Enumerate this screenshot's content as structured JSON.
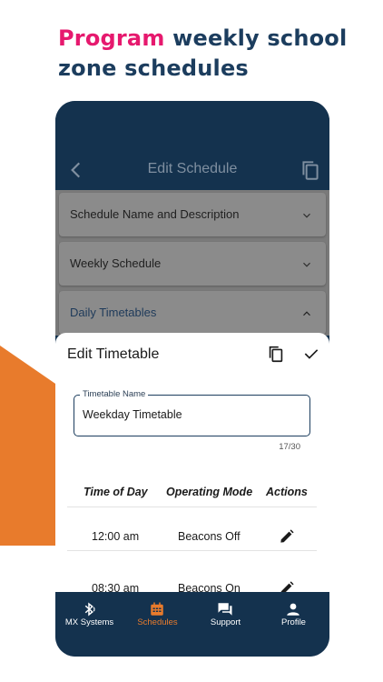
{
  "headline": {
    "accent": "Program",
    "rest": " weekly school zone schedules"
  },
  "colors": {
    "accent_pink": "#e6196e",
    "navy": "#14324e",
    "orange": "#e87b2c"
  },
  "appbar": {
    "title": "Edit Schedule",
    "back_icon": "chevron-left-icon",
    "copy_icon": "copy-icon"
  },
  "sections": [
    {
      "label": "Schedule Name and Description",
      "expanded": false
    },
    {
      "label": "Weekly Schedule",
      "expanded": false
    },
    {
      "label": "Daily Timetables",
      "expanded": true
    }
  ],
  "sheet": {
    "title": "Edit Timetable",
    "field_label": "Timetable Name",
    "field_value": "Weekday Timetable",
    "counter": "17/30",
    "columns": [
      "Time of Day",
      "Operating Mode",
      "Actions"
    ],
    "rows": [
      {
        "time": "12:00 am",
        "mode": "Beacons Off"
      },
      {
        "time": "08:30 am",
        "mode": "Beacons On"
      }
    ]
  },
  "nav": [
    {
      "label": "MX Systems",
      "icon": "bluetooth-icon",
      "active": false
    },
    {
      "label": "Schedules",
      "icon": "calendar-icon",
      "active": true
    },
    {
      "label": "Support",
      "icon": "chat-icon",
      "active": false
    },
    {
      "label": "Profile",
      "icon": "person-icon",
      "active": false
    }
  ]
}
